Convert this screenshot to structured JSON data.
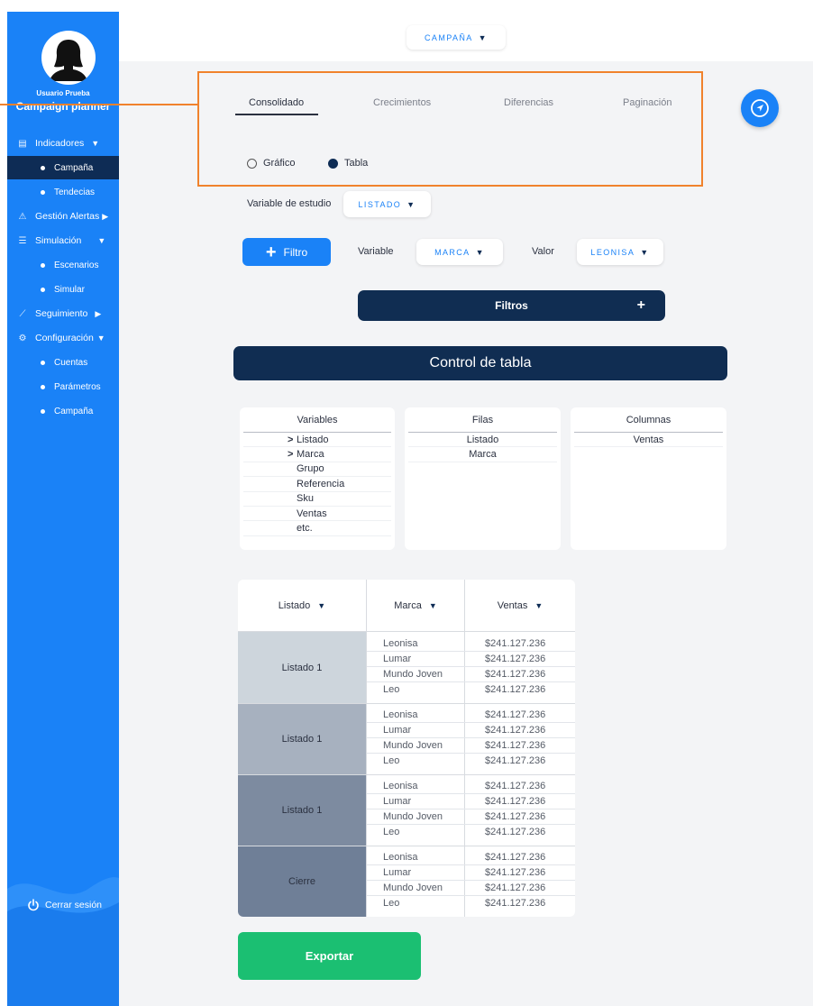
{
  "sidebar": {
    "user_name": "Usuario Prueba",
    "app_name": "Campaign planner",
    "sections": [
      {
        "label": "Indicadores",
        "icon": "document-icon",
        "arrow": "▼"
      },
      {
        "label": "Gestión Alertas",
        "icon": "warning-icon",
        "arrow": "▶"
      },
      {
        "label": "Simulación",
        "icon": "sliders-icon",
        "arrow": "▼"
      },
      {
        "label": "Seguimiento",
        "icon": "chart-line-icon",
        "arrow": "▶"
      },
      {
        "label": "Configuración",
        "icon": "gear-icon",
        "arrow": "▼"
      }
    ],
    "sub_items": {
      "campana": "Campaña",
      "tendecias": "Tendecias",
      "escenarios": "Escenarios",
      "simular": "Simular",
      "cuentas": "Cuentas",
      "parametros": "Parámetros",
      "campana2": "Campaña"
    },
    "active_item": "Campaña",
    "logout_label": "Cerrar sesión"
  },
  "topbar": {
    "campaign_dropdown": "CAMPAÑA"
  },
  "tabs": [
    "Consolidado",
    "Crecimientos",
    "Diferencias",
    "Paginación"
  ],
  "active_tab": "Consolidado",
  "view_mode": {
    "options": [
      "Gráfico",
      "Tabla"
    ],
    "selected": "Tabla"
  },
  "study": {
    "label": "Variable de estudio",
    "value": "LISTADO"
  },
  "filter_row": {
    "button_label": "Filtro",
    "variable_label": "Variable",
    "variable_value": "MARCA",
    "valor_label": "Valor",
    "valor_value": "LEONISA"
  },
  "filters_bar_label": "Filtros",
  "control_title": "Control de tabla",
  "control": {
    "variables_header": "Variables",
    "variables": [
      "Listado",
      "Marca",
      "Grupo",
      "Referencia",
      "Sku",
      "Ventas",
      "etc."
    ],
    "filas_header": "Filas",
    "filas": [
      "Listado",
      "Marca"
    ],
    "columnas_header": "Columnas",
    "columnas": [
      "Ventas"
    ]
  },
  "table": {
    "headers": [
      "Listado",
      "Marca",
      "Ventas"
    ],
    "groups": [
      {
        "label": "Listado 1",
        "color": "#cdd5dc",
        "rows": [
          [
            "Leonisa",
            "$241.127.236"
          ],
          [
            "Lumar",
            "$241.127.236"
          ],
          [
            "Mundo Joven",
            "$241.127.236"
          ],
          [
            "Leo",
            "$241.127.236"
          ]
        ]
      },
      {
        "label": "Listado 1",
        "color": "#a7b1bf",
        "rows": [
          [
            "Leonisa",
            "$241.127.236"
          ],
          [
            "Lumar",
            "$241.127.236"
          ],
          [
            "Mundo Joven",
            "$241.127.236"
          ],
          [
            "Leo",
            "$241.127.236"
          ]
        ]
      },
      {
        "label": "Listado 1",
        "color": "#7d8ba0",
        "rows": [
          [
            "Leonisa",
            "$241.127.236"
          ],
          [
            "Lumar",
            "$241.127.236"
          ],
          [
            "Mundo Joven",
            "$241.127.236"
          ],
          [
            "Leo",
            "$241.127.236"
          ]
        ]
      },
      {
        "label": "Cierre",
        "color": "#6f7f97",
        "rows": [
          [
            "Leonisa",
            "$241.127.236"
          ],
          [
            "Lumar",
            "$241.127.236"
          ],
          [
            "Mundo Joven",
            "$241.127.236"
          ],
          [
            "Leo",
            "$241.127.236"
          ]
        ]
      }
    ]
  },
  "export_label": "Exportar",
  "colors": {
    "primary": "#1a82f7",
    "navy": "#102d52",
    "accent_orange": "#f0822c",
    "export_green": "#1bbf72"
  }
}
